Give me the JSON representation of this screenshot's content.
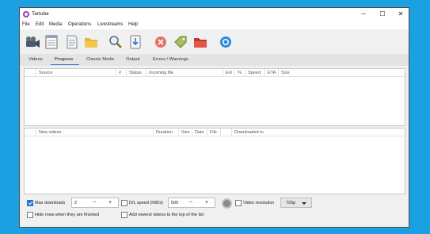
{
  "window": {
    "title": "Tartube",
    "minimize": "─",
    "maximize": "☐",
    "close": "✕"
  },
  "menu": [
    "File",
    "Edit",
    "Media",
    "Operations",
    "Livestreams",
    "Help"
  ],
  "tabs": [
    "Videos",
    "Progress",
    "Classic Mode",
    "Output",
    "Errors / Warnings"
  ],
  "active_tab": "Progress",
  "progress_table": {
    "columns": [
      "Source",
      "#",
      "Status",
      "Incoming file",
      "Ext",
      "%",
      "Speed",
      "ETA",
      "Size"
    ]
  },
  "new_videos_table": {
    "columns": [
      "New videos",
      "Duration",
      "Size",
      "Date",
      "File",
      "Downloaded to"
    ]
  },
  "footer": {
    "max_downloads": {
      "label": "Max downloads",
      "checked": true,
      "value": "2"
    },
    "dl_speed": {
      "label": "D/L speed (KiB/s)",
      "checked": false,
      "value": "500"
    },
    "video_resolution": {
      "label": "Video resolution",
      "checked": false,
      "value": "720p"
    },
    "hide_rows": {
      "label": "Hide rows when they are finished",
      "checked": false
    },
    "add_newest": {
      "label": "Add newest videos to the top of the list",
      "checked": false
    },
    "minus": "−",
    "plus": "+"
  },
  "colors": {
    "desktop": "#1ba1e2",
    "accent": "#2c72d3"
  },
  "toolbar_icons": [
    "film-camera-icon",
    "table-icon",
    "document-icon",
    "folder-icon",
    "magnifier-icon",
    "download-icon",
    "stop-icon",
    "tag-icon",
    "delete-folder-icon",
    "refresh-circle-icon"
  ]
}
